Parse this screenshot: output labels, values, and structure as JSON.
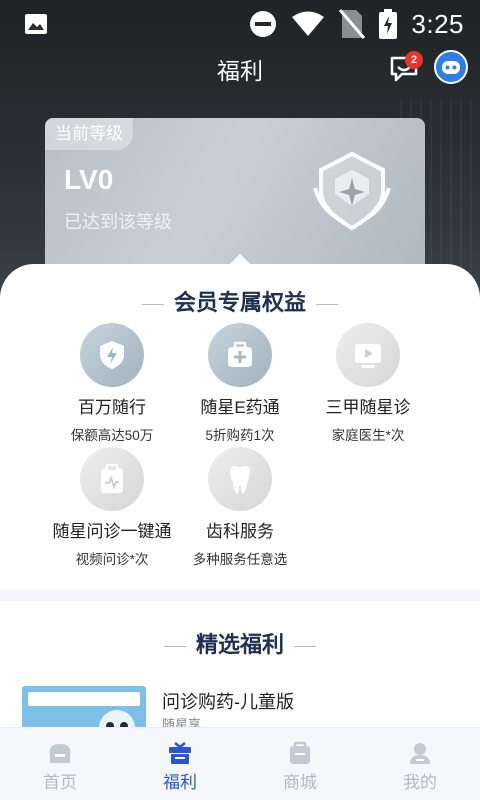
{
  "status_bar": {
    "time": "3:25"
  },
  "nav": {
    "title": "福利",
    "message_badge": "2"
  },
  "level_card": {
    "tag": "当前等级",
    "level": "LV0",
    "desc": "已达到该等级"
  },
  "member_benefits": {
    "title": "会员专属权益",
    "items": [
      {
        "name": "百万随行",
        "sub": "保额高达50万",
        "icon": "shield-lightning-icon"
      },
      {
        "name": "随星E药通",
        "sub": "5折购药1次",
        "icon": "medicine-box-icon"
      },
      {
        "name": "三甲随星诊",
        "sub": "家庭医生*次",
        "icon": "video-screen-icon"
      },
      {
        "name": "随星问诊一键通",
        "sub": "视频问诊*次",
        "icon": "clipboard-pulse-icon"
      },
      {
        "name": "齿科服务",
        "sub": "多种服务任意选",
        "icon": "tooth-icon"
      }
    ]
  },
  "featured": {
    "title": "精选福利",
    "items": [
      {
        "title": "问诊购药-儿童版",
        "sub": "随星享"
      }
    ]
  },
  "tabs": [
    {
      "label": "首页",
      "active": false,
      "icon": "home-icon"
    },
    {
      "label": "福利",
      "active": true,
      "icon": "gift-icon"
    },
    {
      "label": "商城",
      "active": false,
      "icon": "shop-bag-icon"
    },
    {
      "label": "我的",
      "active": false,
      "icon": "user-icon"
    }
  ],
  "colors": {
    "accent": "#2a55d4",
    "badge": "#e8342b",
    "title": "#1f2f55"
  }
}
